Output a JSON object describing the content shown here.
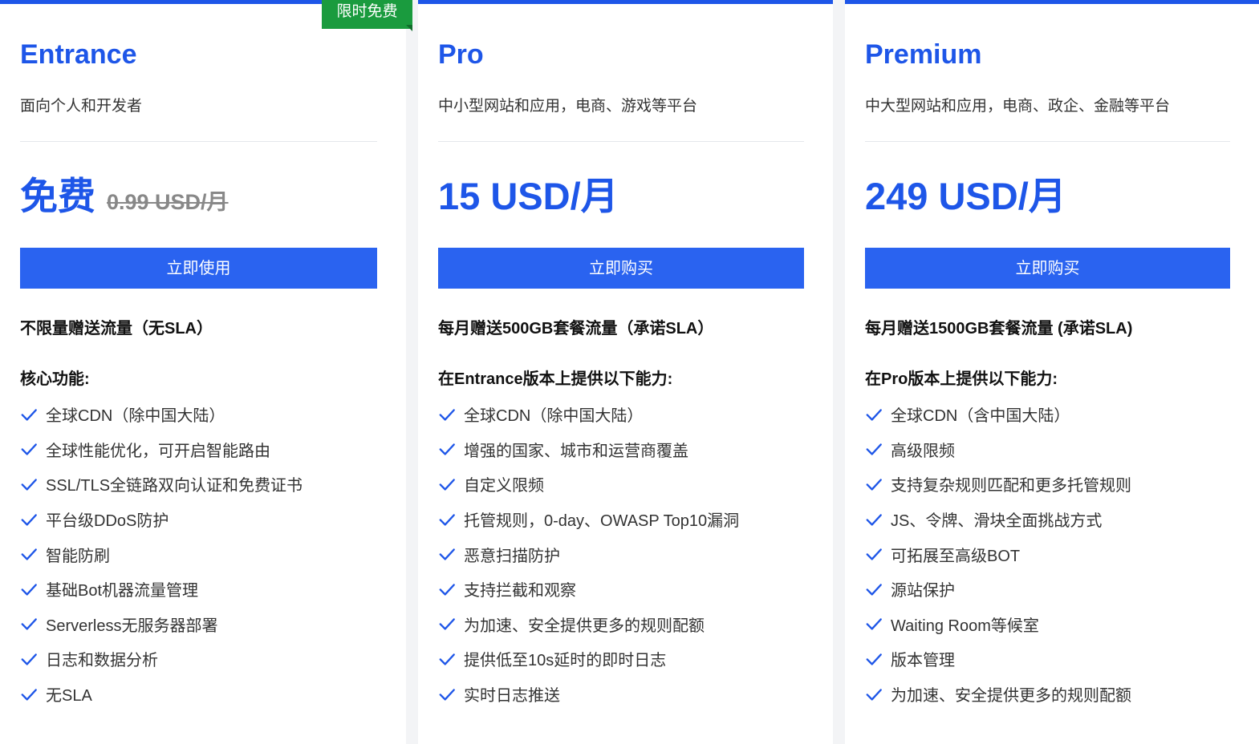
{
  "colors": {
    "accent": "#1e56e8",
    "button": "#2a63f0",
    "badge": "#1a9b3e"
  },
  "plans": [
    {
      "name": "Entrance",
      "badge": "限时免费",
      "desc": "面向个人和开发者",
      "price": "免费",
      "old_price": "0.99 USD/月",
      "cta": "立即使用",
      "traffic": "不限量赠送流量（无SLA）",
      "feature_head": "核心功能:",
      "features": [
        "全球CDN（除中国大陆）",
        "全球性能优化，可开启智能路由",
        "SSL/TLS全链路双向认证和免费证书",
        "平台级DDoS防护",
        "智能防刷",
        "基础Bot机器流量管理",
        "Serverless无服务器部署",
        "日志和数据分析",
        "无SLA"
      ]
    },
    {
      "name": "Pro",
      "desc": "中小型网站和应用，电商、游戏等平台",
      "price": "15 USD/月",
      "cta": "立即购买",
      "traffic": "每月赠送500GB套餐流量（承诺SLA）",
      "feature_head": "在Entrance版本上提供以下能力:",
      "features": [
        "全球CDN（除中国大陆）",
        "增强的国家、城市和运营商覆盖",
        "自定义限频",
        "托管规则，0-day、OWASP Top10漏洞",
        "恶意扫描防护",
        "支持拦截和观察",
        "为加速、安全提供更多的规则配额",
        "提供低至10s延时的即时日志",
        "实时日志推送"
      ]
    },
    {
      "name": "Premium",
      "desc": "中大型网站和应用，电商、政企、金融等平台",
      "price": "249 USD/月",
      "cta": "立即购买",
      "traffic": "每月赠送1500GB套餐流量 (承诺SLA)",
      "feature_head": "在Pro版本上提供以下能力:",
      "features": [
        "全球CDN（含中国大陆）",
        "高级限频",
        "支持复杂规则匹配和更多托管规则",
        "JS、令牌、滑块全面挑战方式",
        "可拓展至高级BOT",
        "源站保护",
        "Waiting Room等候室",
        "版本管理",
        "为加速、安全提供更多的规则配额"
      ]
    }
  ]
}
